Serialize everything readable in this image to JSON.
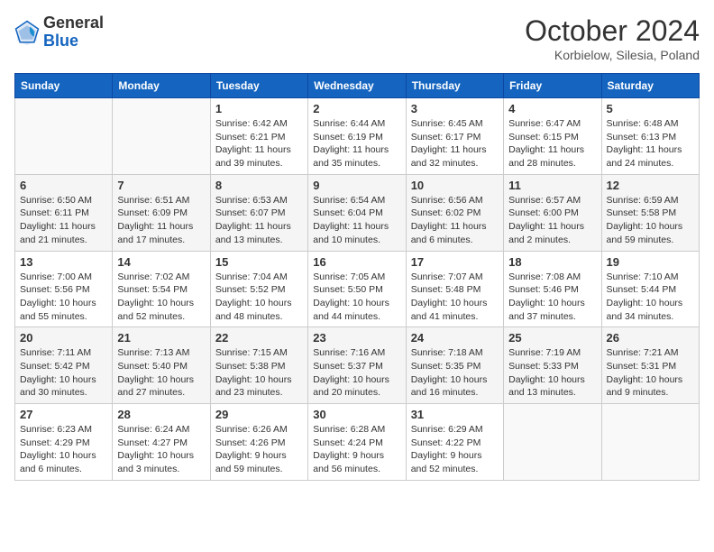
{
  "header": {
    "logo_general": "General",
    "logo_blue": "Blue",
    "month": "October 2024",
    "location": "Korbielow, Silesia, Poland"
  },
  "weekdays": [
    "Sunday",
    "Monday",
    "Tuesday",
    "Wednesday",
    "Thursday",
    "Friday",
    "Saturday"
  ],
  "weeks": [
    [
      {
        "day": "",
        "info": ""
      },
      {
        "day": "",
        "info": ""
      },
      {
        "day": "1",
        "info": "Sunrise: 6:42 AM\nSunset: 6:21 PM\nDaylight: 11 hours and 39 minutes."
      },
      {
        "day": "2",
        "info": "Sunrise: 6:44 AM\nSunset: 6:19 PM\nDaylight: 11 hours and 35 minutes."
      },
      {
        "day": "3",
        "info": "Sunrise: 6:45 AM\nSunset: 6:17 PM\nDaylight: 11 hours and 32 minutes."
      },
      {
        "day": "4",
        "info": "Sunrise: 6:47 AM\nSunset: 6:15 PM\nDaylight: 11 hours and 28 minutes."
      },
      {
        "day": "5",
        "info": "Sunrise: 6:48 AM\nSunset: 6:13 PM\nDaylight: 11 hours and 24 minutes."
      }
    ],
    [
      {
        "day": "6",
        "info": "Sunrise: 6:50 AM\nSunset: 6:11 PM\nDaylight: 11 hours and 21 minutes."
      },
      {
        "day": "7",
        "info": "Sunrise: 6:51 AM\nSunset: 6:09 PM\nDaylight: 11 hours and 17 minutes."
      },
      {
        "day": "8",
        "info": "Sunrise: 6:53 AM\nSunset: 6:07 PM\nDaylight: 11 hours and 13 minutes."
      },
      {
        "day": "9",
        "info": "Sunrise: 6:54 AM\nSunset: 6:04 PM\nDaylight: 11 hours and 10 minutes."
      },
      {
        "day": "10",
        "info": "Sunrise: 6:56 AM\nSunset: 6:02 PM\nDaylight: 11 hours and 6 minutes."
      },
      {
        "day": "11",
        "info": "Sunrise: 6:57 AM\nSunset: 6:00 PM\nDaylight: 11 hours and 2 minutes."
      },
      {
        "day": "12",
        "info": "Sunrise: 6:59 AM\nSunset: 5:58 PM\nDaylight: 10 hours and 59 minutes."
      }
    ],
    [
      {
        "day": "13",
        "info": "Sunrise: 7:00 AM\nSunset: 5:56 PM\nDaylight: 10 hours and 55 minutes."
      },
      {
        "day": "14",
        "info": "Sunrise: 7:02 AM\nSunset: 5:54 PM\nDaylight: 10 hours and 52 minutes."
      },
      {
        "day": "15",
        "info": "Sunrise: 7:04 AM\nSunset: 5:52 PM\nDaylight: 10 hours and 48 minutes."
      },
      {
        "day": "16",
        "info": "Sunrise: 7:05 AM\nSunset: 5:50 PM\nDaylight: 10 hours and 44 minutes."
      },
      {
        "day": "17",
        "info": "Sunrise: 7:07 AM\nSunset: 5:48 PM\nDaylight: 10 hours and 41 minutes."
      },
      {
        "day": "18",
        "info": "Sunrise: 7:08 AM\nSunset: 5:46 PM\nDaylight: 10 hours and 37 minutes."
      },
      {
        "day": "19",
        "info": "Sunrise: 7:10 AM\nSunset: 5:44 PM\nDaylight: 10 hours and 34 minutes."
      }
    ],
    [
      {
        "day": "20",
        "info": "Sunrise: 7:11 AM\nSunset: 5:42 PM\nDaylight: 10 hours and 30 minutes."
      },
      {
        "day": "21",
        "info": "Sunrise: 7:13 AM\nSunset: 5:40 PM\nDaylight: 10 hours and 27 minutes."
      },
      {
        "day": "22",
        "info": "Sunrise: 7:15 AM\nSunset: 5:38 PM\nDaylight: 10 hours and 23 minutes."
      },
      {
        "day": "23",
        "info": "Sunrise: 7:16 AM\nSunset: 5:37 PM\nDaylight: 10 hours and 20 minutes."
      },
      {
        "day": "24",
        "info": "Sunrise: 7:18 AM\nSunset: 5:35 PM\nDaylight: 10 hours and 16 minutes."
      },
      {
        "day": "25",
        "info": "Sunrise: 7:19 AM\nSunset: 5:33 PM\nDaylight: 10 hours and 13 minutes."
      },
      {
        "day": "26",
        "info": "Sunrise: 7:21 AM\nSunset: 5:31 PM\nDaylight: 10 hours and 9 minutes."
      }
    ],
    [
      {
        "day": "27",
        "info": "Sunrise: 6:23 AM\nSunset: 4:29 PM\nDaylight: 10 hours and 6 minutes."
      },
      {
        "day": "28",
        "info": "Sunrise: 6:24 AM\nSunset: 4:27 PM\nDaylight: 10 hours and 3 minutes."
      },
      {
        "day": "29",
        "info": "Sunrise: 6:26 AM\nSunset: 4:26 PM\nDaylight: 9 hours and 59 minutes."
      },
      {
        "day": "30",
        "info": "Sunrise: 6:28 AM\nSunset: 4:24 PM\nDaylight: 9 hours and 56 minutes."
      },
      {
        "day": "31",
        "info": "Sunrise: 6:29 AM\nSunset: 4:22 PM\nDaylight: 9 hours and 52 minutes."
      },
      {
        "day": "",
        "info": ""
      },
      {
        "day": "",
        "info": ""
      }
    ]
  ]
}
